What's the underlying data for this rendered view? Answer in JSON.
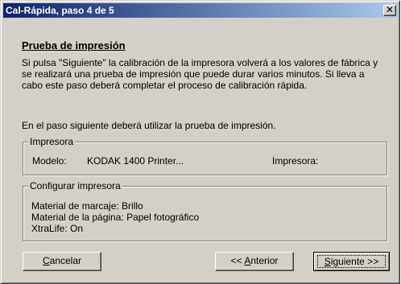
{
  "window": {
    "title": "Cal-Rápida, paso 4 de 5",
    "close_glyph": "✕"
  },
  "content": {
    "heading": "Prueba de impresión",
    "paragraph1": "Si pulsa \"Siguiente\" la calibración de la impresora volverá a los valores de fábrica y se realizará una prueba de impresión que puede durar varios minutos. Si lleva a cabo este paso deberá completar el proceso de calibración rápida.",
    "paragraph2": "En el paso siguiente deberá utilizar la prueba de impresión."
  },
  "printer_group": {
    "legend": "Impresora",
    "model_label": "Modelo:",
    "model_value": "KODAK 1400 Printer...",
    "printer_label": "Impresora:"
  },
  "config_group": {
    "legend": "Configurar impresora",
    "lines": [
      "Material de marcaje: Brillo",
      "Material de la página: Papel fotográfico",
      "XtraLife: On"
    ]
  },
  "buttons": {
    "cancel": {
      "mnemonic": "C",
      "rest": "ancelar"
    },
    "previous": {
      "prefix": "<< ",
      "mnemonic": "A",
      "rest": "nterior"
    },
    "next": {
      "mnemonic": "S",
      "rest": "iguiente >>"
    }
  }
}
